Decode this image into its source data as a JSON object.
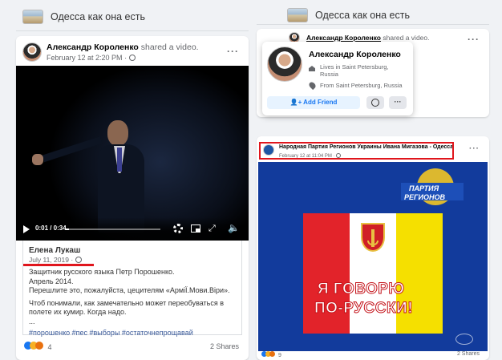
{
  "left": {
    "group_title": "Одесса как она есть",
    "post": {
      "author": "Александр Короленко",
      "action": "shared a video.",
      "date": "February 12 at 2:20 PM",
      "video_time": "0:01 / 0:34",
      "progress": 0.03
    },
    "shared": {
      "author": "Елена Лукаш",
      "date": "July 11, 2019",
      "lines": [
        "Защитник русского языка Петр Порошенко.",
        "Апрель 2014.",
        "Перешлите это, пожалуйста, цецителям «АрміЇ.Мови.Віри».",
        "",
        "Чтоб понимали, как замечательно может переобуваться в",
        "полете их кумир. Когда надо.",
        "..."
      ],
      "hashtags": "#порошенко #пес #выборы #остаточнепрощавай"
    },
    "footer": {
      "reactions": "4",
      "shares": "2 Shares"
    }
  },
  "right": {
    "group_title": "Одесса как она есть",
    "post1": {
      "author": "Александр Короленко",
      "action": "shared a video."
    },
    "hovercard": {
      "name": "Александр Короленко",
      "lives": "Lives in Saint Petersburg, Russia",
      "from": "From Saint Petersburg, Russia",
      "add_friend": "Add Friend"
    },
    "post2": {
      "page": "Народная Партия Регионов Украины Ивана Мигазова - Одесса",
      "date": "February 12 at 11:04 PM",
      "logo_top": "ПАРТИЯ",
      "logo_bottom": "РЕГИОНОВ",
      "banner_line1": "Я ГОВОРЮ",
      "banner_line2": "ПО-РУССКИ!",
      "reactions": "9",
      "shares": "2 Shares"
    },
    "highlight_color": "#e0161d"
  }
}
